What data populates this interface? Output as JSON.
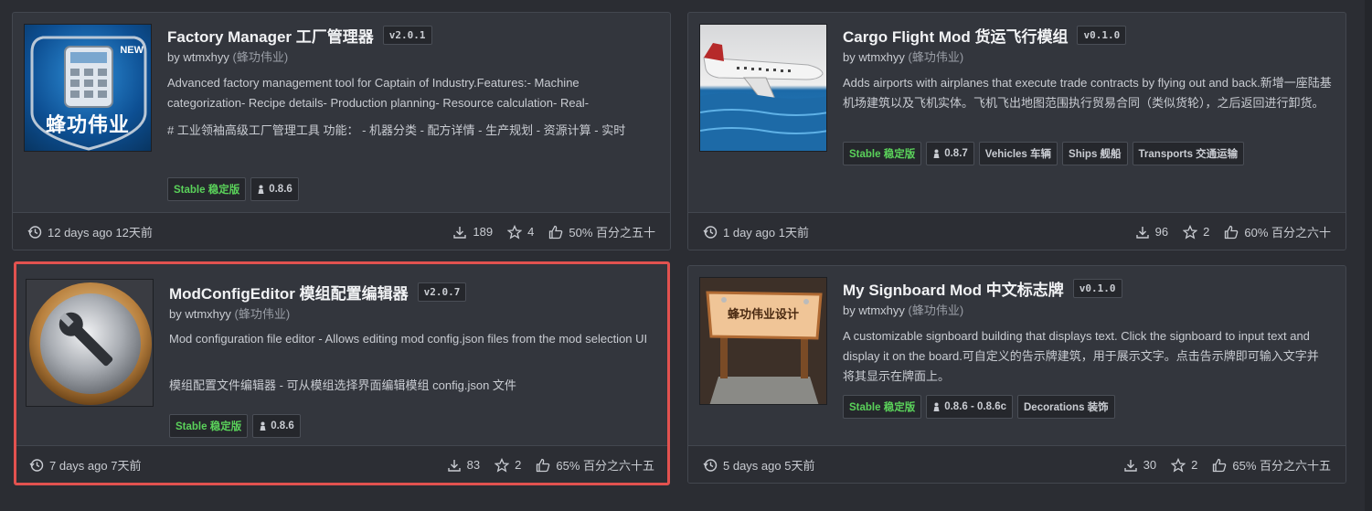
{
  "cards": [
    {
      "title": "Factory Manager 工厂管理器",
      "version": "v2.0.1",
      "author_prefix": "by wtmxhyy",
      "author_cn": "(蜂功伟业)",
      "desc1": "Advanced factory management tool for Captain of Industry.Features:- Machine categorization- Recipe details- Production planning- Resource calculation- Real-",
      "desc2": "# 工业领袖高级工厂管理工具 功能： - 机器分类 - 配方详情 - 生产规划 - 资源计算 - 实时",
      "thumb_badge": "NEW",
      "thumb_text": "蜂功伟业",
      "tags": [
        {
          "label": "Stable 稳定版",
          "kind": "stable"
        },
        {
          "label": "0.8.6",
          "kind": "game"
        }
      ],
      "date": "12 days ago 12天前",
      "downloads": "189",
      "stars": "4",
      "rating": "50% 百分之五十"
    },
    {
      "title": "Cargo Flight Mod 货运飞行模组",
      "version": "v0.1.0",
      "author_prefix": "by wtmxhyy",
      "author_cn": "(蜂功伟业)",
      "desc1": "Adds airports with airplanes that execute trade contracts by flying out and back.新增一座陆基机场建筑以及飞机实体。飞机飞出地图范围执行贸易合同（类似货轮），之后返回进行卸货。",
      "desc2": "",
      "tags": [
        {
          "label": "Stable 稳定版",
          "kind": "stable"
        },
        {
          "label": "0.8.7",
          "kind": "game"
        },
        {
          "label": "Vehicles 车辆",
          "kind": "cat"
        },
        {
          "label": "Ships 舰船",
          "kind": "cat"
        },
        {
          "label": "Transports 交通运输",
          "kind": "cat"
        }
      ],
      "date": "1 day ago 1天前",
      "downloads": "96",
      "stars": "2",
      "rating": "60% 百分之六十"
    },
    {
      "title": "ModConfigEditor 模组配置编辑器",
      "version": "v2.0.7",
      "author_prefix": "by wtmxhyy",
      "author_cn": "(蜂功伟业)",
      "desc1": "Mod configuration file editor - Allows editing mod config.json files from the mod selection UI",
      "desc2": "模组配置文件编辑器 - 可从模组选择界面编辑模组 config.json 文件",
      "tags": [
        {
          "label": "Stable 稳定版",
          "kind": "stable"
        },
        {
          "label": "0.8.6",
          "kind": "game"
        }
      ],
      "date": "7 days ago 7天前",
      "downloads": "83",
      "stars": "2",
      "rating": "65% 百分之六十五"
    },
    {
      "title": "My Signboard Mod 中文标志牌",
      "version": "v0.1.0",
      "author_prefix": "by wtmxhyy",
      "author_cn": "(蜂功伟业)",
      "desc1": "A customizable signboard building that displays text. Click the signboard to input text and display it on the board.可自定义的告示牌建筑，用于展示文字。点击告示牌即可输入文字并将其显示在牌面上。",
      "desc2": "",
      "thumb_text": "蜂功伟业设计",
      "tags": [
        {
          "label": "Stable 稳定版",
          "kind": "stable"
        },
        {
          "label": "0.8.6 - 0.8.6c",
          "kind": "game"
        },
        {
          "label": "Decorations 装饰",
          "kind": "cat"
        }
      ],
      "date": "5 days ago 5天前",
      "downloads": "30",
      "stars": "2",
      "rating": "65% 百分之六十五"
    }
  ],
  "colors": {
    "background": "#2b2d33",
    "card": "#33363d",
    "stable": "#5ad15a",
    "selection": "#e2524f"
  }
}
